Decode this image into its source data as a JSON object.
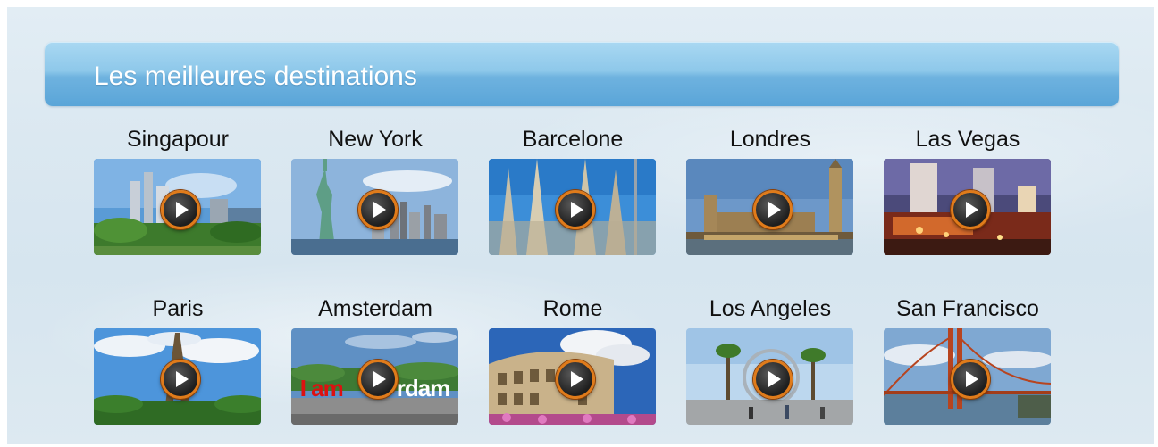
{
  "header": {
    "title": "Les meilleures destinations"
  },
  "destinations": [
    {
      "name": "Singapour"
    },
    {
      "name": "New York"
    },
    {
      "name": "Barcelone"
    },
    {
      "name": "Londres"
    },
    {
      "name": "Las Vegas"
    },
    {
      "name": "Paris"
    },
    {
      "name": "Amsterdam",
      "sign_left": "I am",
      "sign_right": "rdam"
    },
    {
      "name": "Rome"
    },
    {
      "name": "Los Angeles"
    },
    {
      "name": "San Francisco"
    }
  ],
  "colors": {
    "header": "#6eb2df",
    "play_ring": "#e07b1a"
  }
}
